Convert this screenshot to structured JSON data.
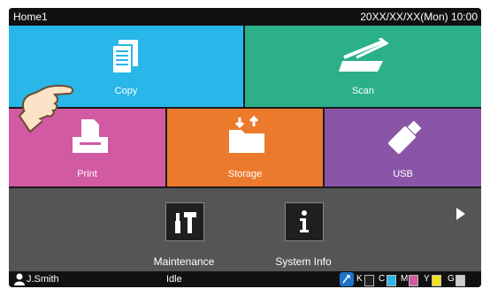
{
  "header": {
    "title": "Home1",
    "datetime": "20XX/XX/XX(Mon) 10:00"
  },
  "tiles": {
    "copy": {
      "label": "Copy",
      "color": "#29b6e8",
      "icon": "copy-icon"
    },
    "scan": {
      "label": "Scan",
      "color": "#2bb08a",
      "icon": "scan-icon"
    },
    "print": {
      "label": "Print",
      "color": "#d15aa2",
      "icon": "print-icon"
    },
    "storage": {
      "label": "Storage",
      "color": "#ec7a2d",
      "icon": "storage-folder-icon"
    },
    "usb": {
      "label": "USB",
      "color": "#8a55a7",
      "icon": "usb-icon"
    }
  },
  "lower": {
    "maintenance": {
      "label": "Maintenance",
      "icon": "maintenance-tools-icon"
    },
    "system_info": {
      "label": "System Info",
      "icon": "info-icon"
    }
  },
  "status": {
    "user": "J.Smith",
    "state": "Idle",
    "inks": [
      {
        "label": "K",
        "color": "#222222"
      },
      {
        "label": "C",
        "color": "#29b6e8"
      },
      {
        "label": "M",
        "color": "#d15aa2"
      },
      {
        "label": "Y",
        "color": "#f3e01f"
      },
      {
        "label": "G",
        "color": "#cccccc"
      }
    ]
  }
}
